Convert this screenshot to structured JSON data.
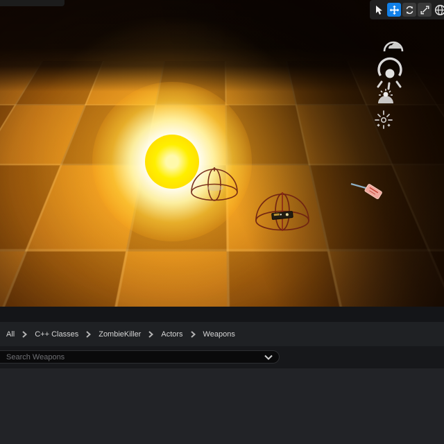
{
  "colors": {
    "accent_blue": "#1180e8",
    "orb_core_yellow": "#ffee00",
    "glow_orange": "#ef9b18",
    "gizmo_wire_red": "#6f2212",
    "panel_dark": "#1f2124"
  },
  "viewport": {
    "toolbar": {
      "tools": [
        {
          "name": "select",
          "icon": "cursor-icon",
          "active": false
        },
        {
          "name": "translate",
          "icon": "move-icon",
          "active": true
        },
        {
          "name": "rotate",
          "icon": "rotate-icon",
          "active": false
        },
        {
          "name": "scale",
          "icon": "scale-icon",
          "active": false
        },
        {
          "name": "coordinate-space",
          "icon": "globe-icon",
          "active": false
        }
      ]
    },
    "scene": {
      "light": {
        "name": "point-light-orb"
      },
      "actor_sprites": [
        {
          "name": "volumetric-cloud",
          "icon": "cloud-dome-icon"
        },
        {
          "name": "directional-light",
          "icon": "light-rays-icon"
        },
        {
          "name": "sky-light",
          "icon": "dome-sun-icon"
        },
        {
          "name": "sky-atmosphere",
          "icon": "sparkle-icon"
        }
      ],
      "gizmos": [
        {
          "name": "pickup-sphere-left"
        },
        {
          "name": "pickup-sphere-right"
        }
      ],
      "props": [
        {
          "name": "pistol-pickup"
        },
        {
          "name": "rifle-pickup"
        }
      ]
    }
  },
  "content_browser": {
    "breadcrumb": [
      {
        "label": "All"
      },
      {
        "label": "C++ Classes"
      },
      {
        "label": "ZombieKiller"
      },
      {
        "label": "Actors"
      },
      {
        "label": "Weapons"
      }
    ],
    "search": {
      "placeholder": "Search Weapons",
      "icon": "chevron-down-icon"
    }
  }
}
